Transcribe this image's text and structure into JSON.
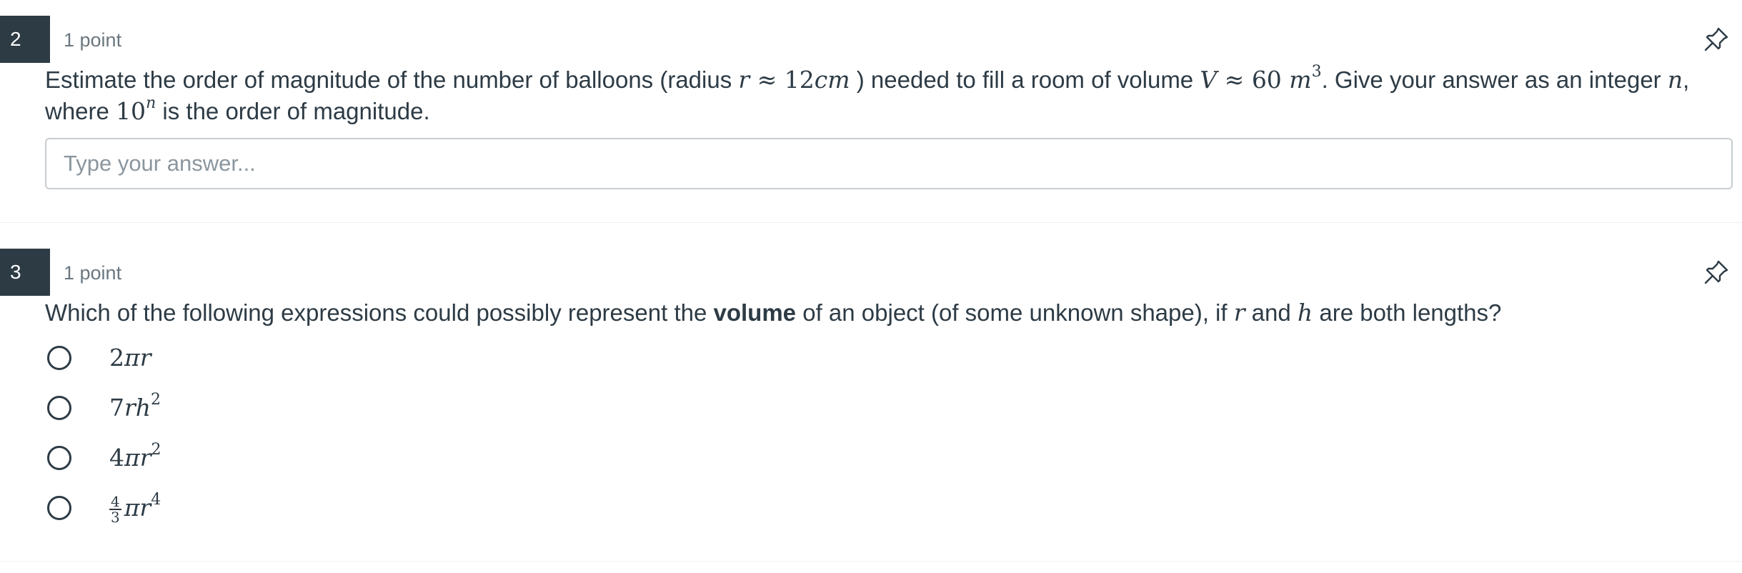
{
  "questions": [
    {
      "number": "2",
      "points": "1 point",
      "prompt": {
        "t1": "Estimate the order of magnitude of the number of balloons (radius ",
        "m_r": "r",
        "m_approx1": " ≈ ",
        "m_12": "12",
        "m_cm": "cm",
        "t2": " ) needed to fill a room of volume ",
        "m_V": "V",
        "m_approx2": " ≈ ",
        "m_60": "60 ",
        "m_m": "m",
        "sup_3": "3",
        "t3": ". Give your answer as an integer ",
        "m_n": "n",
        "t4": ", where ",
        "m_10": "10",
        "sup_n": "n",
        "t5": " is the order of magnitude."
      },
      "answer": {
        "placeholder": "Type your answer...",
        "value": ""
      },
      "pin_icon": "pin-icon"
    },
    {
      "number": "3",
      "points": "1 point",
      "prompt": {
        "t1": "Which of the following expressions could possibly represent the ",
        "bold": "volume",
        "t2": " of an object (of some unknown shape), if ",
        "m_r": "r",
        "t3": " and ",
        "m_h": "h",
        "t4": " are both lengths?"
      },
      "choices": [
        {
          "coef": "2",
          "expr": "πr",
          "sup": ""
        },
        {
          "coef": "7",
          "expr": "rh",
          "sup": "2"
        },
        {
          "coef": "4",
          "expr": "πr",
          "sup": "2"
        },
        {
          "frac_num": "4",
          "frac_den": "3",
          "expr": "πr",
          "sup": "4"
        }
      ],
      "pin_icon": "pin-icon"
    }
  ],
  "colors": {
    "text": "#2d3b45",
    "muted": "#6b7780",
    "number_badge_bg": "#2d3b45",
    "input_border": "#c7cdd1",
    "divider": "#eceff1"
  }
}
